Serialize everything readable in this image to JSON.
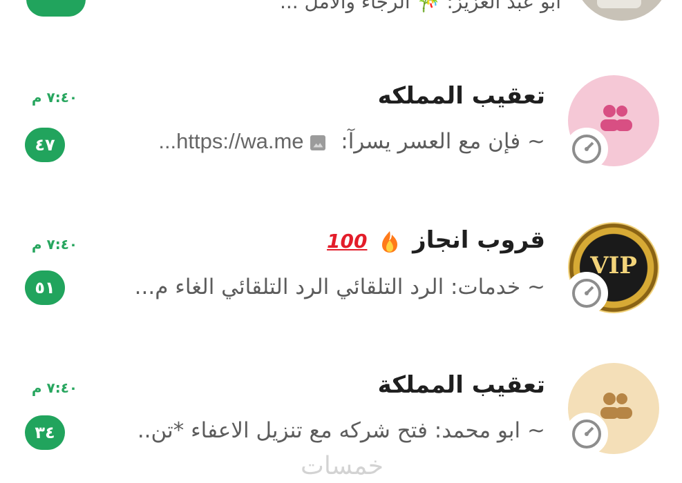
{
  "top_partial": {
    "preview": "ابو عبد العزيز: 🎋 الرجاء والامل ..."
  },
  "chats": [
    {
      "title": "تعقيب المملكه",
      "time": "٧:٤٠ م",
      "preview": "~ فإن مع العسر يسرآ:",
      "link_text": "https://wa.me...",
      "unread": "٤٧",
      "avatar": "group-icon"
    },
    {
      "title": "قروب انجاز",
      "emojis": [
        "fire",
        "hundred-points"
      ],
      "hundred_label": "100",
      "time": "٧:٤٠ م",
      "preview": "~ خدمات: الرد التلقائي  الرد التلقائي  الغاء م...",
      "unread": "٥١",
      "avatar": "vip-logo",
      "avatar_text": "VIP"
    },
    {
      "title": "تعقيب المملكة",
      "time": "٧:٤٠ م",
      "preview": "~ ابو محمد: فتح شركه مع تنزيل الاعفاء *تن..",
      "unread": "٣٤",
      "avatar": "group-icon"
    }
  ],
  "watermark": "خمسات",
  "colors": {
    "accent": "#21a45d",
    "pink_avatar": "#f5c8d6",
    "beige_avatar": "#f4dfb8"
  }
}
